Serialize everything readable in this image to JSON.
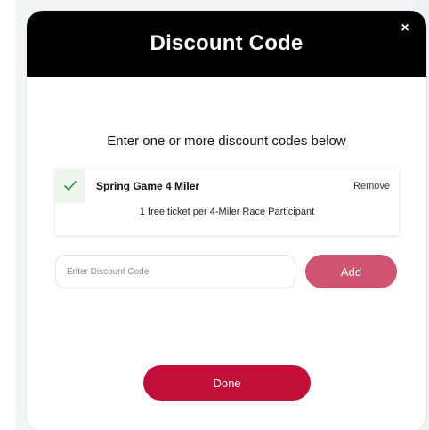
{
  "modal": {
    "title": "Discount Code",
    "close_label": "×",
    "subtitle": "Enter one or more discount codes below"
  },
  "applied_codes": [
    {
      "name": "Spring Game 4 Miler",
      "remove_label": "Remove",
      "description": "1 free ticket per 4-Miler Race Participant",
      "status_icon": "check-icon"
    }
  ],
  "entry": {
    "placeholder": "Enter Discount Code",
    "value": "",
    "add_label": "Add"
  },
  "footer": {
    "done_label": "Done"
  },
  "colors": {
    "header_bg": "#000000",
    "add_button": "#cf5471",
    "done_button": "#c0103a",
    "check": "#2e8b3a"
  }
}
